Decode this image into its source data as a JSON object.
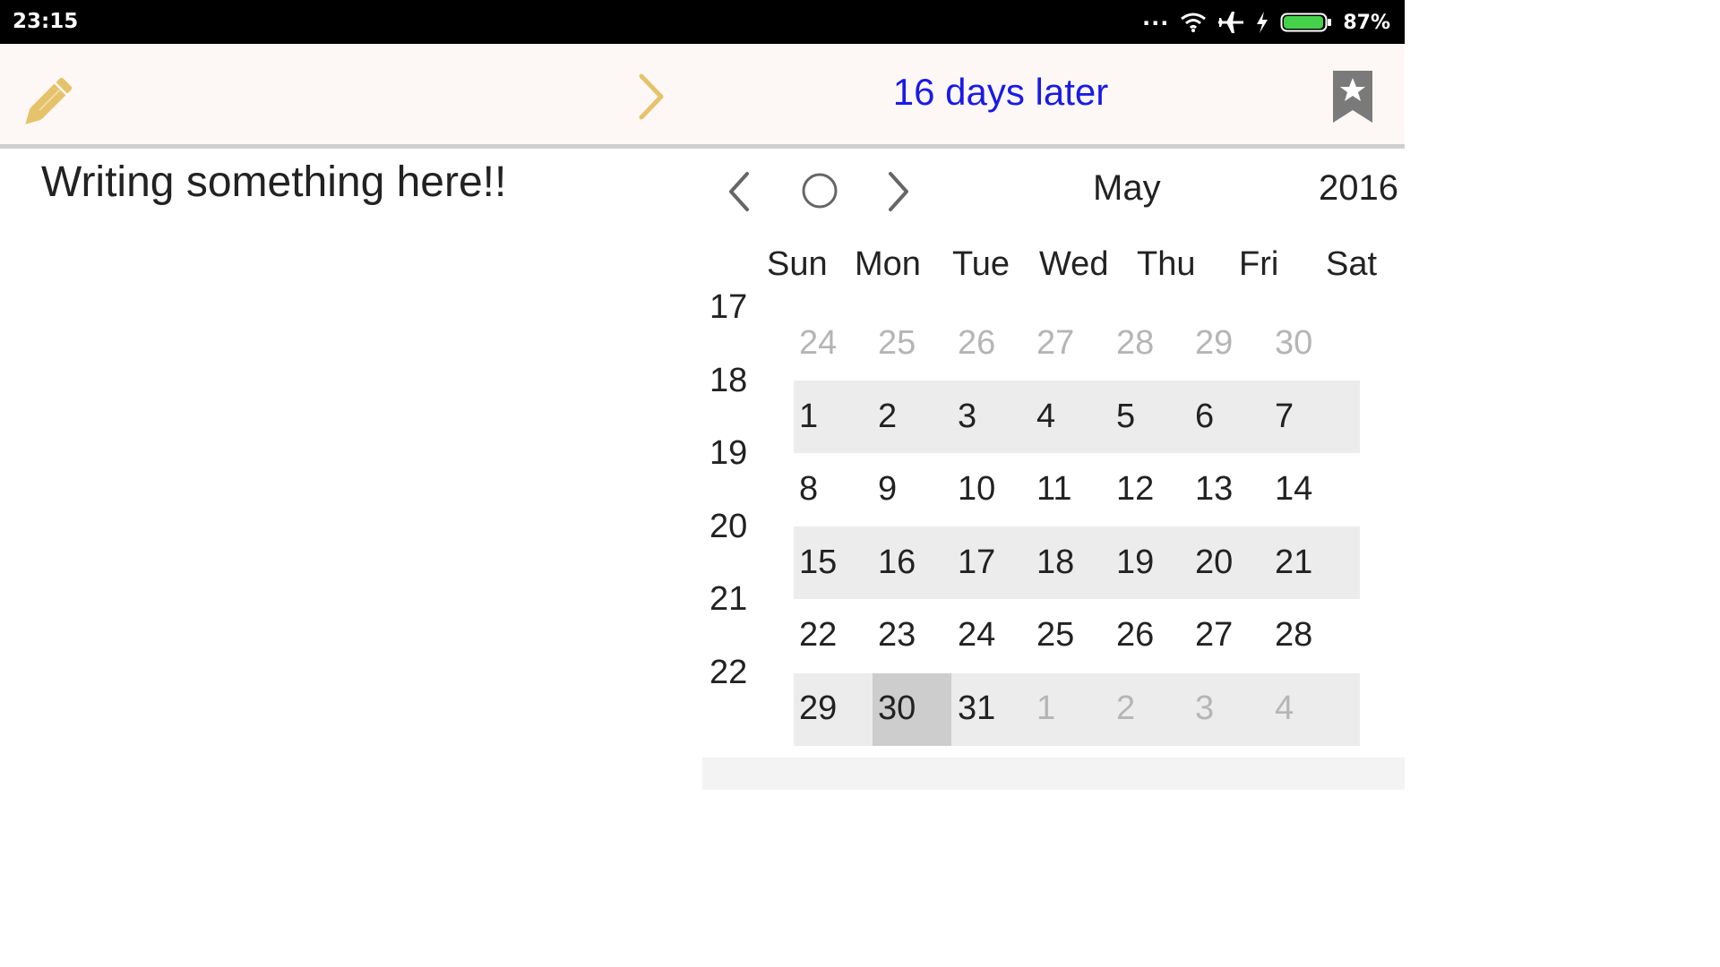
{
  "status_bar": {
    "time": "23:15",
    "dots": "...",
    "battery": "87%"
  },
  "toolbar": {
    "days_label": "16  days later"
  },
  "note": {
    "text": "Writing something here!!"
  },
  "calendar": {
    "month": "May",
    "year": "2016",
    "weekday_headers": [
      "Sun",
      "Mon",
      "Tue",
      "Wed",
      "Thu",
      "Fri",
      "Sat"
    ],
    "week_numbers": [
      "17",
      "18",
      "19",
      "20",
      "21",
      "22"
    ],
    "weeks": [
      [
        "24",
        "25",
        "26",
        "27",
        "28",
        "29",
        "30"
      ],
      [
        "1",
        "2",
        "3",
        "4",
        "5",
        "6",
        "7"
      ],
      [
        "8",
        "9",
        "10",
        "11",
        "12",
        "13",
        "14"
      ],
      [
        "15",
        "16",
        "17",
        "18",
        "19",
        "20",
        "21"
      ],
      [
        "22",
        "23",
        "24",
        "25",
        "26",
        "27",
        "28"
      ],
      [
        "29",
        "30",
        "31",
        "1",
        "2",
        "3",
        "4"
      ]
    ],
    "selected_day": "30"
  },
  "colors": {
    "accent_gold": "#e6c36a",
    "days_blue": "#1a1ae6",
    "bookmark_gray": "#7a7a7a"
  },
  "icons": [
    "pencil-icon",
    "chevron-right-icon",
    "bookmark-star-icon",
    "chevron-left-icon",
    "circle-today-icon"
  ]
}
